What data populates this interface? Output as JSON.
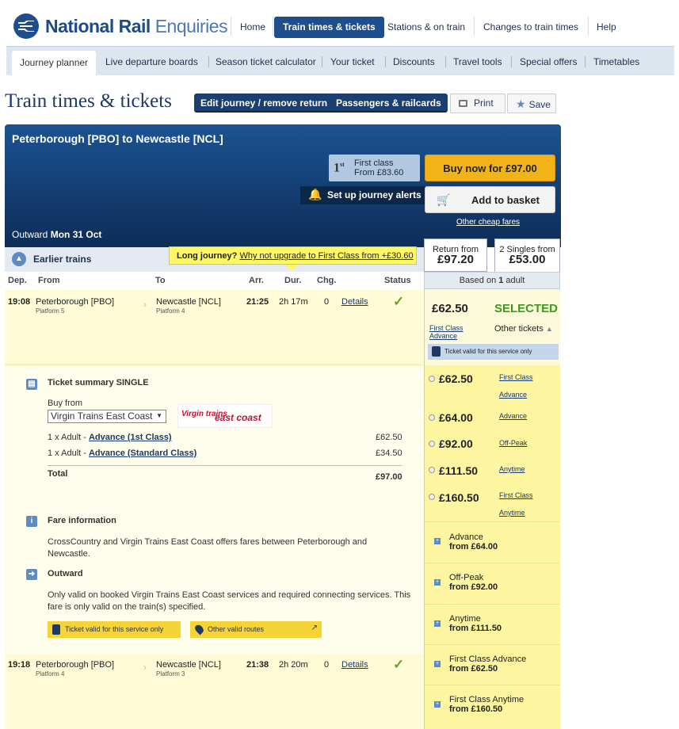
{
  "brand": {
    "name_bold": "National Rail",
    "name_light": " Enquiries"
  },
  "topnav": {
    "home": "Home",
    "train_times": "Train times & tickets",
    "stations": "Stations & on train",
    "changes": "Changes to train times",
    "help": "Help"
  },
  "subnav": {
    "journey_planner": "Journey planner",
    "live_departure": "Live departure boards",
    "season_ticket": "Season ticket calculator",
    "your_ticket": "Your ticket",
    "discounts": "Discounts",
    "travel_tools": "Travel tools",
    "special_offers": "Special offers",
    "timetables": "Timetables"
  },
  "page": {
    "title": "Train times & tickets",
    "edit_journey": "Edit journey / remove return",
    "passengers": "Passengers & railcards",
    "print": "Print",
    "save": "Save"
  },
  "journey": {
    "route": "Peterborough [PBO] to Newcastle [NCL]",
    "first_class_label": "First class",
    "first_class_from": "From £83.60",
    "buy_now": "Buy now for £97.00",
    "alerts": "Set up journey alerts",
    "add_basket": "Add to basket",
    "other_cheap": "Other cheap fares",
    "outward_label": "Outward",
    "outward_date": "Mon 31 Oct"
  },
  "tabs": {
    "return_label": "Return from",
    "return_price": "£97.20",
    "singles_label": "2 Singles from",
    "singles_price": "£53.00",
    "based_on_prefix": "Based on ",
    "based_on_count": "1",
    "based_on_suffix": " adult"
  },
  "earlier": {
    "label": "Earlier trains"
  },
  "upgrade": {
    "prefix": "Long journey?",
    "link": "Why not upgrade to First Class from +£30.60"
  },
  "columns": {
    "dep": "Dep.",
    "from": "From",
    "to": "To",
    "arr": "Arr.",
    "dur": "Dur.",
    "chg": "Chg.",
    "status": "Status"
  },
  "trains": [
    {
      "dep": "19:08",
      "from": "Peterborough [PBO]",
      "from_platform": "Platform 5",
      "to": "Newcastle [NCL]",
      "to_platform": "Platform 4",
      "arr": "21:25",
      "dur": "2h 17m",
      "chg": "0",
      "details": "Details",
      "status": "✓"
    },
    {
      "dep": "19:18",
      "from": "Peterborough [PBO]",
      "from_platform": "Platform 4",
      "to": "Newcastle [NCL]",
      "to_platform": "Platform 3",
      "arr": "21:38",
      "dur": "2h 20m",
      "chg": "0",
      "details": "Details",
      "status": "✓"
    }
  ],
  "summary": {
    "title": "Ticket summary SINGLE",
    "buy_from": "Buy from",
    "operator": "Virgin Trains East Coast",
    "logo_script": "Virgin trains",
    "logo_text": "east coast",
    "line1_prefix": "1 x Adult - ",
    "line1_link": "Advance (1st Class)",
    "line1_price": "£62.50",
    "line2_prefix": "1 x Adult - ",
    "line2_link": "Advance (Standard Class)",
    "line2_price": "£34.50",
    "total_label": "Total",
    "total_price": "£97.00",
    "fare_info_title": "Fare information",
    "fare_info_text1": "CrossCountry and Virgin Trains East Coast offers fares between Peterborough and",
    "fare_info_text2": "Newcastle.",
    "outward_title": "Outward",
    "outward_text1": "Only valid on booked Virgin Trains East Coast services and required connecting services. This",
    "outward_text2": "fare is only valid on the train(s) specified.",
    "tag_valid": "Ticket valid for this service only",
    "tag_routes": "Other valid routes"
  },
  "selected_fare": {
    "price": "£62.50",
    "status": "SELECTED",
    "type_line1": "First Class",
    "type_line2": "Advance",
    "other_tickets": "Other tickets",
    "valid": "Ticket valid for this service only"
  },
  "fare_options": [
    {
      "price": "£62.50",
      "label1": "First Class",
      "label2": "Advance"
    },
    {
      "price": "£64.00",
      "label1": "Advance",
      "label2": ""
    },
    {
      "price": "£92.00",
      "label1": "Off-Peak",
      "label2": ""
    },
    {
      "price": "£111.50",
      "label1": "Anytime",
      "label2": ""
    },
    {
      "price": "£160.50",
      "label1": "First Class",
      "label2": "Anytime"
    }
  ],
  "alt_fares": [
    {
      "name": "Advance",
      "from": "from £64.00"
    },
    {
      "name": "Off-Peak",
      "from": "from £92.00"
    },
    {
      "name": "Anytime",
      "from": "from £111.50"
    },
    {
      "name": "First Class Advance",
      "from": "from £62.50"
    },
    {
      "name": "First Class Anytime",
      "from": "from £160.50"
    }
  ]
}
